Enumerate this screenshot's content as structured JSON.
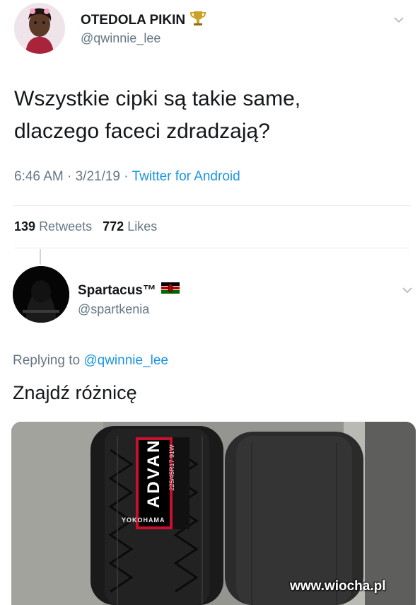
{
  "tweet": {
    "author_name": "OTEDOLA PIKIN",
    "author_handle": "@qwinnie_lee",
    "text_line1": "Wszystkie cipki są takie same,",
    "text_line2": "dlaczego faceci zdradzają?",
    "time": "6:46 AM",
    "date": "3/21/19",
    "source": "Twitter for Android",
    "retweets_count": "139",
    "retweets_label": "Retweets",
    "likes_count": "772",
    "likes_label": "Likes"
  },
  "reply": {
    "author_name": "Spartacus™",
    "author_handle": "@spartkenia",
    "replying_to_label": "Replying to",
    "replying_to_handle": "@qwinnie_lee",
    "text": "Znajdź różnicę",
    "tire_brand": "ADVAN",
    "tire_maker": "YOKOHAMA",
    "tire_size": "225/45R17 91W"
  },
  "watermark": "www.wiocha.pl",
  "colors": {
    "accent": "#1b95e0",
    "muted": "#657786",
    "trophy": "#c9a227"
  }
}
